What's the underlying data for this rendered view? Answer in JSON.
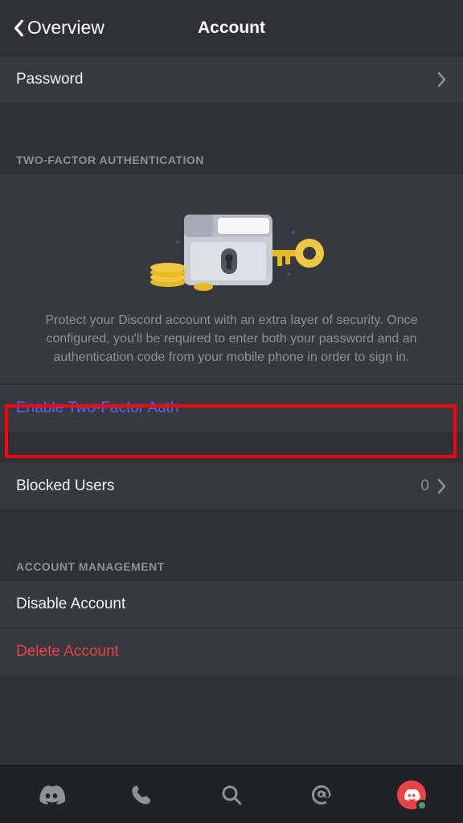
{
  "header": {
    "back_label": "Overview",
    "title": "Account"
  },
  "password_row": {
    "label": "Password"
  },
  "twofa": {
    "section_title": "TWO-FACTOR AUTHENTICATION",
    "description": "Protect your Discord account with an extra layer of security. Once configured, you'll be required to enter both your password and an authentication code from your mobile phone in order to sign in.",
    "enable_label": "Enable Two-Factor Auth"
  },
  "blocked": {
    "label": "Blocked Users",
    "count": "0"
  },
  "account_mgmt": {
    "section_title": "ACCOUNT MANAGEMENT",
    "disable_label": "Disable Account",
    "delete_label": "Delete Account"
  }
}
